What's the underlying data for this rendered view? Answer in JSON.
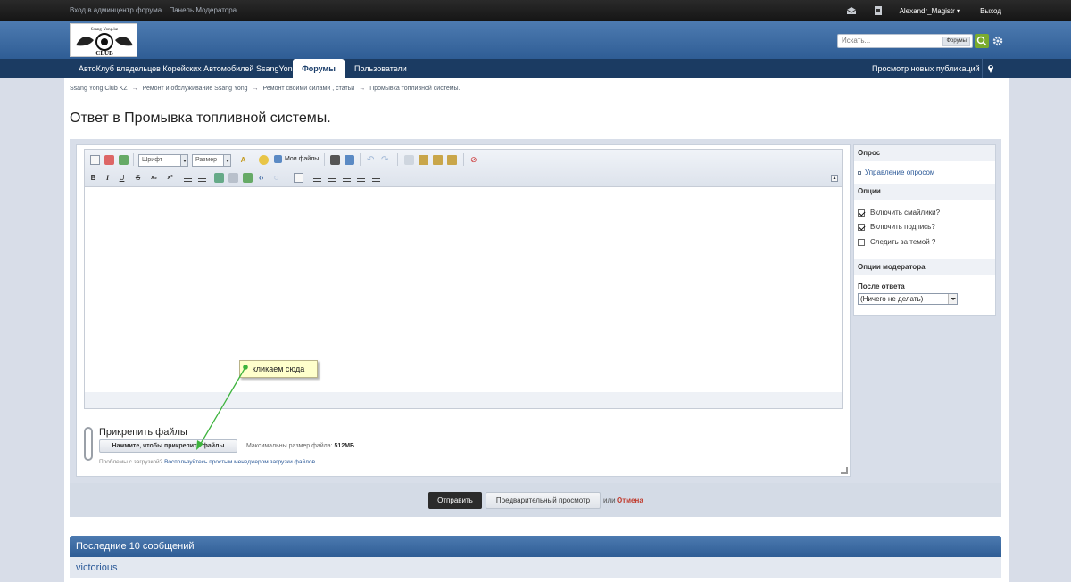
{
  "userbar": {
    "admin_link": "Вход в админцентр форума",
    "mod_link": "Панель Модератора",
    "username": "Alexandr_Magistr",
    "logout": "Выход"
  },
  "search": {
    "placeholder": "Искать...",
    "scope": "Форумы"
  },
  "nav": {
    "items": [
      {
        "label": "АвтоКлуб владельцев Корейских Автомобилей SsangYong"
      },
      {
        "label": "Форумы",
        "active": true
      },
      {
        "label": "Пользователи"
      }
    ],
    "right_link": "Просмотр новых публикаций"
  },
  "breadcrumbs": [
    "Ssang Yong Club KZ",
    "Ремонт и обслуживание Ssang Yong",
    "Ремонт своими силами , статьи",
    "Промывка топливной системы."
  ],
  "page_title": "Ответ в Промывка топливной системы.",
  "toolbar": {
    "font": "Шрифт",
    "size": "Размер",
    "my_files": "Мои файлы",
    "bold": "B",
    "italic": "I",
    "underline": "U",
    "strike": "S",
    "sub": "x₂",
    "sup": "x²"
  },
  "callout": "кликаем сюда",
  "attach": {
    "title": "Прикрепить файлы",
    "button": "Нажмите, чтобы прикрепить файлы",
    "max_label": "Максимальны размер файла:",
    "max_value": "512МБ",
    "help_prefix": "Проблемы с загрузкой?",
    "help_link": "Воспользуйтесь простым менеджером загрузки файлов"
  },
  "sidebar": {
    "poll_head": "Опрос",
    "poll_link": "Управление опросом",
    "options_head": "Опции",
    "options": [
      {
        "label": "Включить смайлики?",
        "checked": true
      },
      {
        "label": "Включить подпись?",
        "checked": true
      },
      {
        "label": "Следить за темой ?",
        "checked": false
      }
    ],
    "mod_head": "Опции модератора",
    "after_reply_label": "После ответа",
    "after_reply_value": "(Ничего не делать)"
  },
  "submit": {
    "send": "Отправить",
    "preview": "Предварительный просмотр",
    "or": "или",
    "cancel": "Отмена"
  },
  "recent": {
    "title": "Последние 10 сообщений",
    "first_author": "victorious"
  },
  "colors": {
    "header_blue": "#3d6ba3",
    "nav_dark": "#1b3b62",
    "search_green": "#7aab2e",
    "cancel_red": "#c0392b",
    "arrow_green": "#3db33d"
  }
}
